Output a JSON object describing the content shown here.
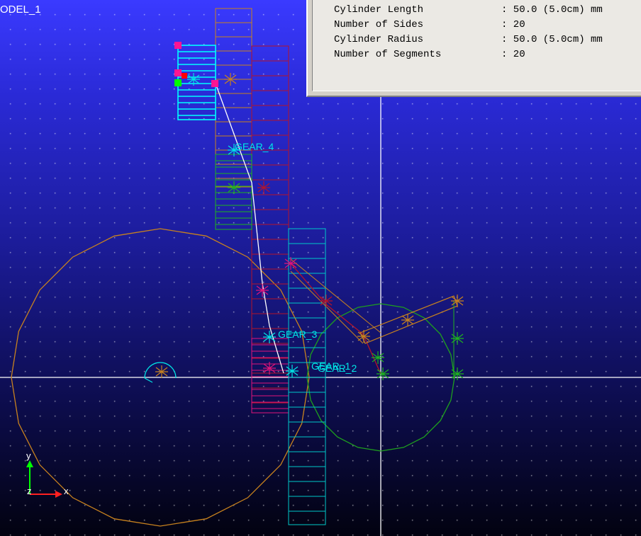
{
  "model_name": "ODEL_1",
  "info_panel": {
    "rows": [
      {
        "label": "Cylinder Length",
        "value": ": 50.0 (5.0cm) mm"
      },
      {
        "label": "Number of Sides",
        "value": ": 20"
      },
      {
        "label": "Cylinder Radius",
        "value": ": 50.0 (5.0cm) mm"
      },
      {
        "label": "Number of Segments",
        "value": ": 20"
      }
    ]
  },
  "parts": {
    "gear_4": "GEAR_4",
    "gear_3": "GEAR_3",
    "gear_1": "GEAR_1",
    "gear_2": "GEAR_2"
  },
  "triad": {
    "y": "y",
    "x": "x",
    "z": "z"
  },
  "colors": {
    "background_top": "#3a3aff",
    "background_bottom": "#020210",
    "large_gear": "#c8821e",
    "small_gear": "#1ea01e",
    "cyan_part": "#00e6e6",
    "red_part": "#c81e3c",
    "magenta_part": "#e0147a",
    "green_part": "#1eb41e",
    "link": "#ffffff",
    "info_panel_bg": "#ebe9e4"
  }
}
